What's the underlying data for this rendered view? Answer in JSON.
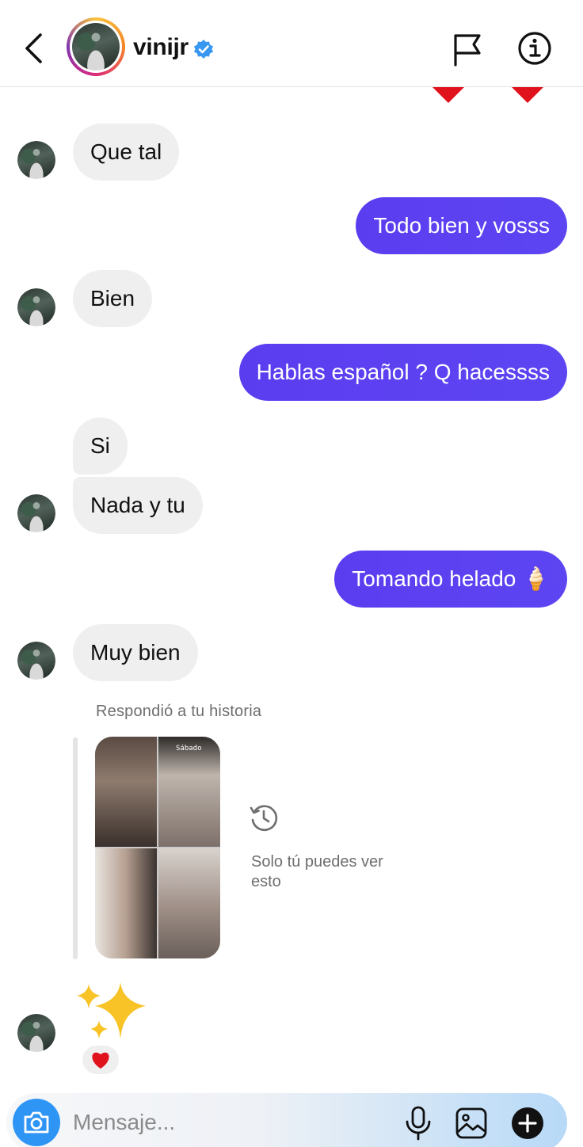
{
  "header": {
    "username": "vinijr",
    "verified": true
  },
  "messages": [
    {
      "id": "m1",
      "direction": "incoming",
      "text": "Que tal"
    },
    {
      "id": "m2",
      "direction": "outgoing",
      "text": "Todo bien y vosss"
    },
    {
      "id": "m3",
      "direction": "incoming",
      "text": "Bien"
    },
    {
      "id": "m4",
      "direction": "outgoing",
      "text": "Hablas español ? Q hacessss"
    },
    {
      "id": "m5",
      "direction": "incoming",
      "text": "Si"
    },
    {
      "id": "m6",
      "direction": "incoming",
      "text": "Nada y tu"
    },
    {
      "id": "m7",
      "direction": "outgoing",
      "text": "Tomando helado 🍦"
    },
    {
      "id": "m8",
      "direction": "incoming",
      "text": "Muy bien"
    }
  ],
  "story_reply": {
    "caption": "Respondió a tu historia",
    "thumb_date": "Sábado",
    "private_note": "Solo tú puedes ver esto"
  },
  "last_message": {
    "content": "sparkles-emoji",
    "reaction": "❤️"
  },
  "composer": {
    "placeholder": "Mensaje..."
  },
  "colors": {
    "outgoing_bubble": "#5b3df0",
    "incoming_bubble": "#efefef",
    "camera_button": "#2f95f5",
    "verified_badge": "#3897f0"
  }
}
